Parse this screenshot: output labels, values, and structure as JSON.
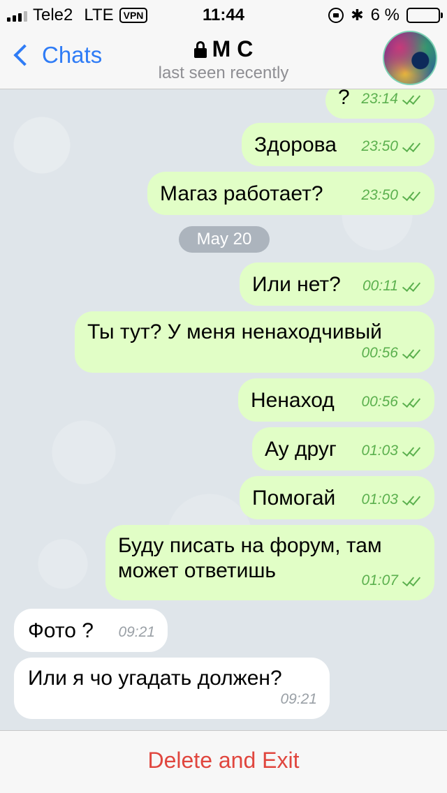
{
  "status_bar": {
    "carrier": "Tele2",
    "network": "LTE",
    "vpn": "VPN",
    "time": "11:44",
    "battery_percent": "6 %",
    "battery_level": 0.06,
    "bluetooth_icon": "✱"
  },
  "nav": {
    "back_label": "Chats",
    "title": "M C",
    "subtitle": "last seen recently"
  },
  "date_separator": "May 20",
  "messages": [
    {
      "dir": "out",
      "text": "?",
      "time": "23:14",
      "read": true
    },
    {
      "dir": "out",
      "text": "Здорова",
      "time": "23:50",
      "read": true
    },
    {
      "dir": "out",
      "text": "Магаз работает?",
      "time": "23:50",
      "read": true
    },
    {
      "dir": "out",
      "text": "Или нет?",
      "time": "00:11",
      "read": true
    },
    {
      "dir": "out",
      "text": "Ты тут? У меня ненаходчивый",
      "time": "00:56",
      "read": true
    },
    {
      "dir": "out",
      "text": "Ненаход",
      "time": "00:56",
      "read": true
    },
    {
      "dir": "out",
      "text": "Ау друг",
      "time": "01:03",
      "read": true
    },
    {
      "dir": "out",
      "text": "Помогай",
      "time": "01:03",
      "read": true
    },
    {
      "dir": "out",
      "text": "Буду писать на форум, там может ответишь",
      "time": "01:07",
      "read": true
    },
    {
      "dir": "in",
      "text": "Фото ?",
      "time": "09:21"
    },
    {
      "dir": "in",
      "text": "Или я чо угадать должен?",
      "time": "09:21"
    }
  ],
  "bottom": {
    "action_label": "Delete and Exit"
  }
}
